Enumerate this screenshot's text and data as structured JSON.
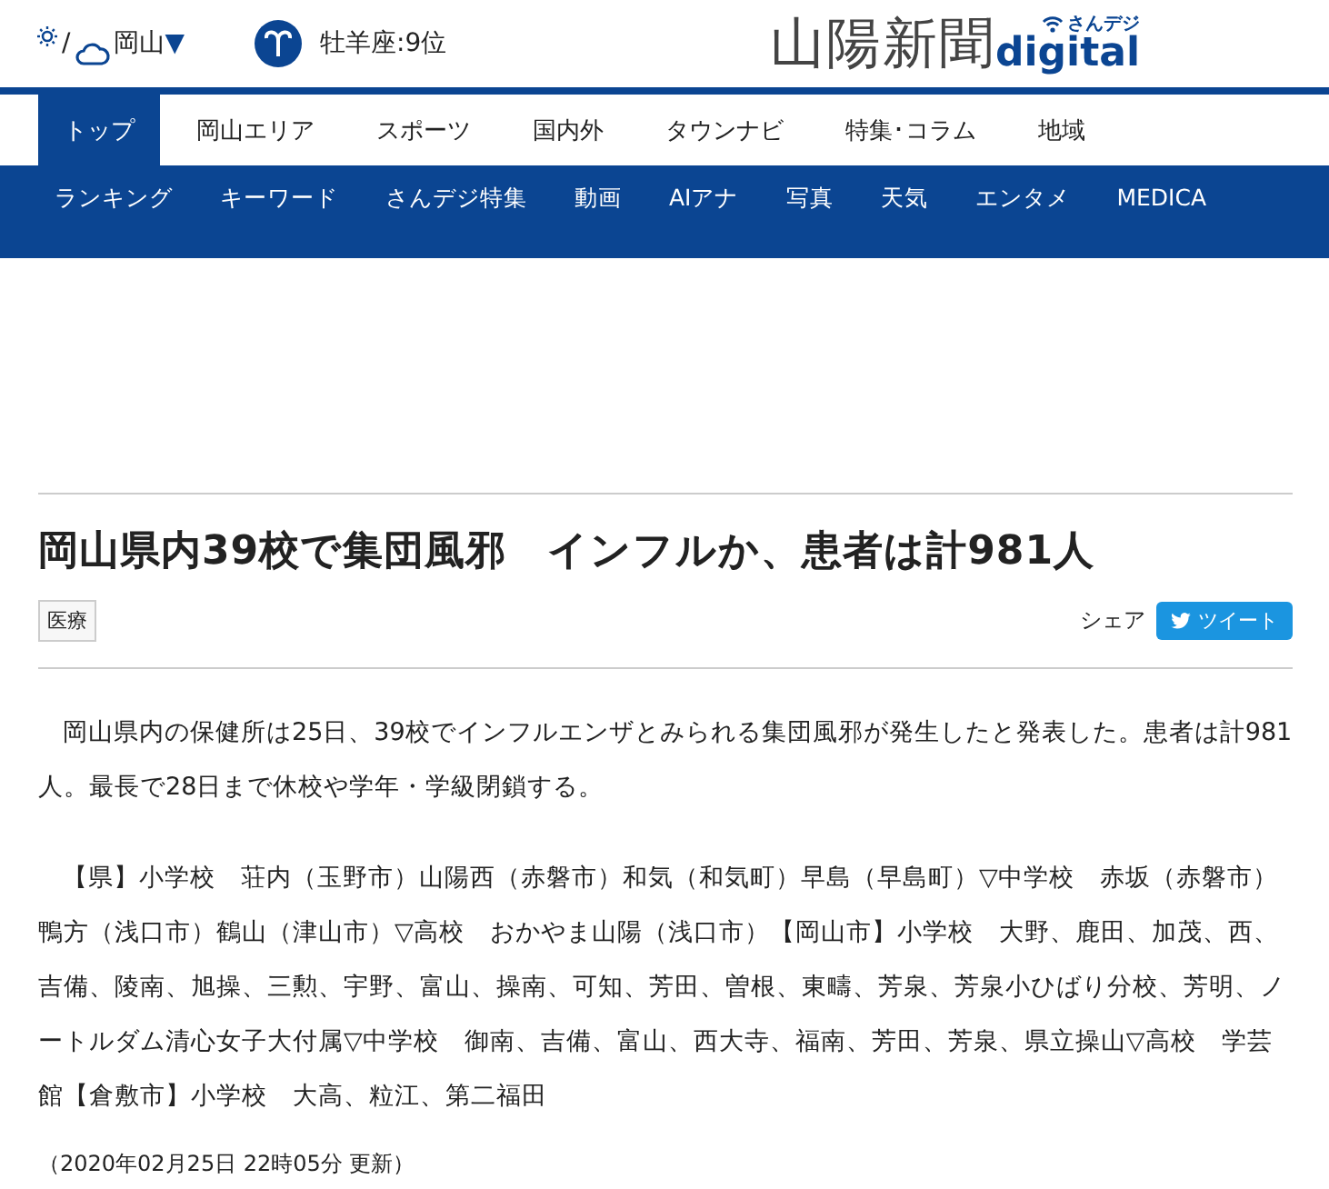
{
  "header": {
    "weather": {
      "separator": "/",
      "city": "岡山",
      "dropdown": "▼"
    },
    "horoscope": "牡羊座:9位",
    "logo": {
      "name": "山陽新聞",
      "tagline": "さんデジ",
      "brand": "digital"
    }
  },
  "nav": [
    {
      "label": "トップ",
      "selected": true
    },
    {
      "label": "岡山エリア",
      "selected": false
    },
    {
      "label": "スポーツ",
      "selected": false
    },
    {
      "label": "国内外",
      "selected": false
    },
    {
      "label": "タウンナビ",
      "selected": false
    },
    {
      "label": "特集･コラム",
      "selected": false
    },
    {
      "label": "地域",
      "selected": false
    }
  ],
  "subnav": [
    "ランキング",
    "キーワード",
    "さんデジ特集",
    "動画",
    "AIアナ",
    "写真",
    "天気",
    "エンタメ",
    "MEDICA"
  ],
  "article": {
    "title": "岡山県内39校で集団風邪　インフルか、患者は計981人",
    "tag": "医療",
    "share_label": "シェア",
    "tweet_button": "ツイート",
    "paragraphs": [
      "岡山県内の保健所は25日、39校でインフルエンザとみられる集団風邪が発生したと発表した。患者は計981人。最長で28日まで休校や学年・学級閉鎖する。",
      "【県】小学校　荘内（玉野市）山陽西（赤磐市）和気（和気町）早島（早島町）▽中学校　赤坂（赤磐市）鴨方（浅口市）鶴山（津山市）▽高校　おかやま山陽（浅口市）【岡山市】小学校　大野、鹿田、加茂、西、吉備、陵南、旭操、三勲、宇野、富山、操南、可知、芳田、曽根、東疇、芳泉、芳泉小ひばり分校、芳明、ノートルダム清心女子大付属▽中学校　御南、吉備、富山、西大寺、福南、芳田、芳泉、県立操山▽高校　学芸館【倉敷市】小学校　大高、粒江、第二福田"
    ],
    "updated": "（2020年02月25日 22時05分 更新）"
  }
}
